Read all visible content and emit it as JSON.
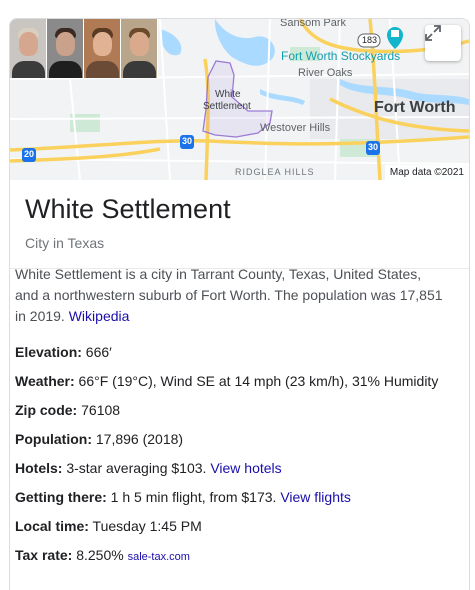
{
  "map": {
    "labels": {
      "sansom_park": "Sansom Park",
      "stockyards": "Fort Worth Stockyards",
      "river_oaks": "River Oaks",
      "white": "White",
      "settlement": "Settlement",
      "fort_worth": "Fort Worth",
      "westover_hills": "Westover Hills",
      "ridglea_hills": "RIDGLEA HILLS",
      "route_183": "183",
      "i20": "20",
      "i30a": "30",
      "i30b": "30"
    },
    "attribution": "Map data ©2021",
    "colors": {
      "water": "#aadaff",
      "highway": "#fbd15d",
      "boundary": "#9c7bd6",
      "poi": "#12b5cb"
    }
  },
  "place": {
    "name": "White Settlement",
    "type": "City in Texas"
  },
  "description": {
    "text": "White Settlement is a city in Tarrant County, Texas, United States, and a northwestern suburb of Fort Worth. The population was 17,851 in 2019.",
    "source_link": "Wikipedia"
  },
  "facts": [
    {
      "label": "Elevation:",
      "value": "666′"
    },
    {
      "label": "Weather:",
      "value": "66°F (19°C), Wind SE at 14 mph (23 km/h), 31% Humidity"
    },
    {
      "label": "Zip code:",
      "value": "76108"
    },
    {
      "label": "Population:",
      "value": "17,896 (2018)"
    },
    {
      "label": "Hotels:",
      "value": "3-star averaging $103.",
      "link": "View hotels"
    },
    {
      "label": "Getting there:",
      "value": "1 h 5 min flight, from $173.",
      "link": "View flights"
    },
    {
      "label": "Local time:",
      "value": "Tuesday 1:45 PM"
    },
    {
      "label": "Tax rate:",
      "value": "8.250%",
      "small_link": "sale-tax.com"
    }
  ]
}
